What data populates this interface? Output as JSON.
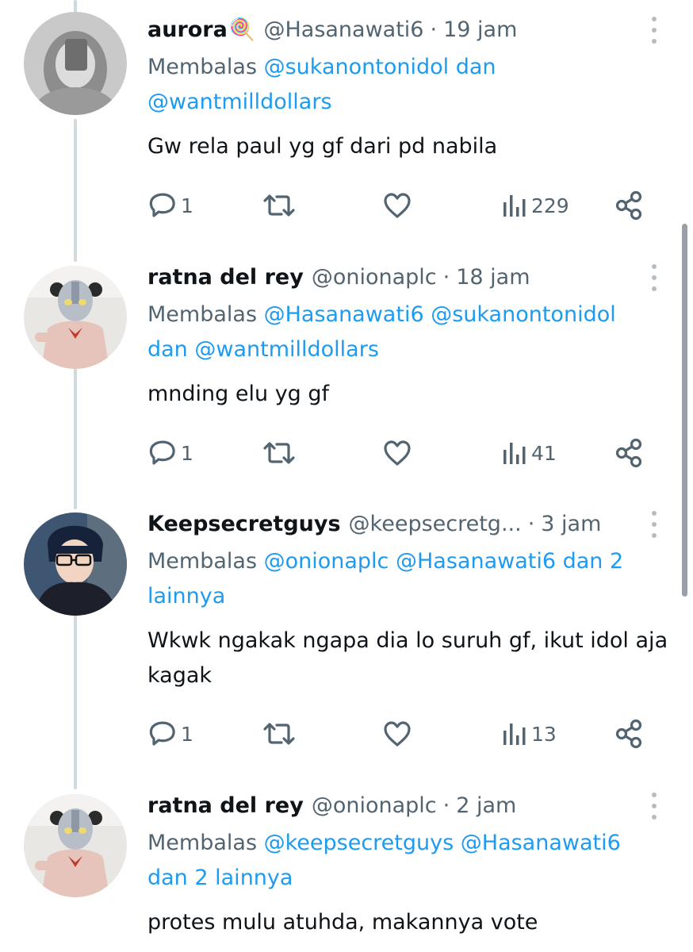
{
  "colors": {
    "text": "#0f1419",
    "secondary": "#536471",
    "accent": "#1d9bf0",
    "thread_line": "#cfd9de"
  },
  "tweets": [
    {
      "name": "aurora",
      "name_emoji": "🍭",
      "handle": "@Hasanawati6",
      "separator": "·",
      "time": "19 jam",
      "reply_prefix": "Membalas",
      "reply_mentions": [
        "@sukanontonidol",
        "dan",
        "@wantmilldollars"
      ],
      "text": "Gw rela paul yg gf dari pd nabila",
      "replies": "1",
      "views": "229",
      "avatar_icon": "avatar-photo-veiled-person"
    },
    {
      "name": "ratna del rey",
      "handle": "@onionaplc",
      "separator": "·",
      "time": "18 jam",
      "reply_prefix": "Membalas",
      "reply_mentions": [
        "@Hasanawati6",
        "@sukanontonidol",
        "dan",
        "@wantmilldollars"
      ],
      "text": "mnding elu yg gf",
      "replies": "1",
      "views": "41",
      "avatar_icon": "avatar-photo-ultraman-mask"
    },
    {
      "name": "Keepsecretguys",
      "handle": "@keepsecretg...",
      "separator": "·",
      "time": "3 jam",
      "reply_prefix": "Membalas",
      "reply_mentions": [
        "@onionaplc",
        "@Hasanawati6",
        "dan 2 lainnya"
      ],
      "text": "Wkwk ngakak ngapa dia lo suruh gf, ikut idol aja kagak",
      "replies": "1",
      "views": "13",
      "avatar_icon": "avatar-anime-character-glasses"
    },
    {
      "name": "ratna del rey",
      "handle": "@onionaplc",
      "separator": "·",
      "time": "2 jam",
      "reply_prefix": "Membalas",
      "reply_mentions": [
        "@keepsecretguys",
        "@Hasanawati6",
        "dan 2 lainnya"
      ],
      "text": "protes mulu atuhda, makannya vote",
      "avatar_icon": "avatar-photo-ultraman-mask"
    }
  ]
}
